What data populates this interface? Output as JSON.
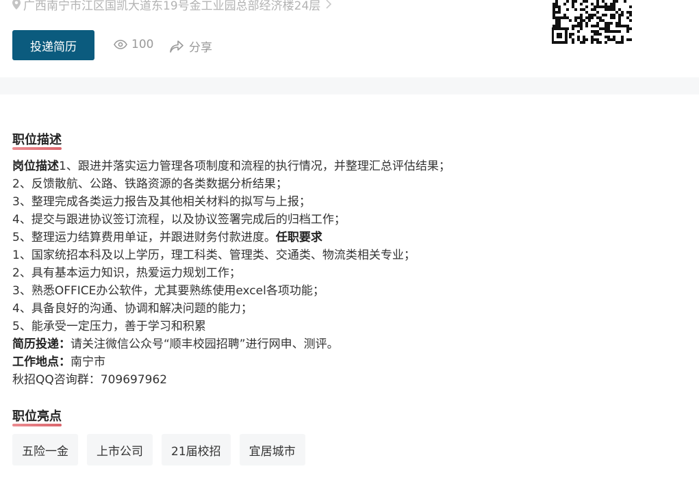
{
  "header": {
    "address": "广西南宁市江区国凯大道东19号金工业园总部经济楼24层",
    "apply_label": "投递简历",
    "views": "100",
    "share_label": "分享"
  },
  "description": {
    "title": "职位描述",
    "lines": [
      {
        "bold": "岗位描述",
        "text": "1、跟进并落实运力管理各项制度和流程的执行情况，并整理汇总评估结果；",
        "tail_bold": ""
      },
      {
        "bold": "",
        "text": "2、反馈散航、公路、铁路资源的各类数据分析结果；",
        "tail_bold": ""
      },
      {
        "bold": "",
        "text": "3、整理完成各类运力报告及其他相关材料的拟写与上报；",
        "tail_bold": ""
      },
      {
        "bold": "",
        "text": "4、提交与跟进协议签订流程，以及协议签署完成后的归档工作；",
        "tail_bold": ""
      },
      {
        "bold": "",
        "text": "5、整理运力结算费用单证，并跟进财务付款进度。",
        "tail_bold": "任职要求"
      },
      {
        "bold": "",
        "text": "1、国家统招本科及以上学历，理工科类、管理类、交通类、物流类相关专业；",
        "tail_bold": ""
      },
      {
        "bold": "",
        "text": "2、具有基本运力知识，热爱运力规划工作；",
        "tail_bold": ""
      },
      {
        "bold": "",
        "text": "3、熟悉OFFICE办公软件，尤其要熟练使用excel各项功能；",
        "tail_bold": ""
      },
      {
        "bold": "",
        "text": "4、具备良好的沟通、协调和解决问题的能力；",
        "tail_bold": ""
      },
      {
        "bold": "",
        "text": "5、能承受一定压力，善于学习和积累",
        "tail_bold": ""
      },
      {
        "bold": "简历投递：",
        "text": "请关注微信公众号“顺丰校园招聘”进行网申、测评。",
        "tail_bold": ""
      },
      {
        "bold": "工作地点：",
        "text": "南宁市",
        "tail_bold": ""
      },
      {
        "bold": "",
        "text": "秋招QQ咨询群：709697962",
        "tail_bold": ""
      }
    ]
  },
  "highlights": {
    "title": "职位亮点",
    "tags": [
      "五险一金",
      "上市公司",
      "21届校招",
      "宜居城市"
    ]
  },
  "colors": {
    "accent": "#0b5b7e",
    "underline": "#d44a52"
  }
}
